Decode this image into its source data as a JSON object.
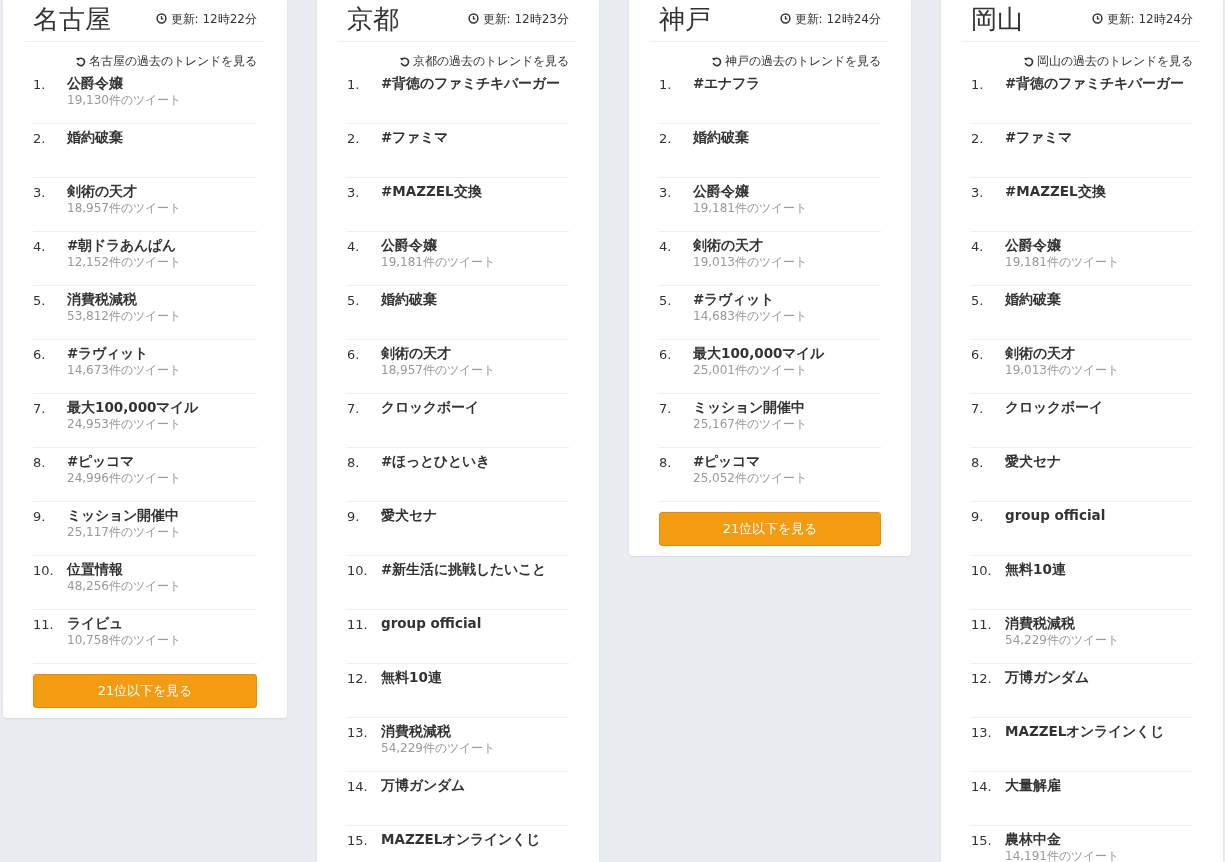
{
  "regions": [
    {
      "city": "名古屋",
      "updated": "更新: 12時22分",
      "history_link": "名古屋の過去のトレンドを見る",
      "trends": [
        {
          "rank": "1.",
          "title": "公爵令嬢",
          "count": "19,130件のツイート"
        },
        {
          "rank": "2.",
          "title": "婚約破棄"
        },
        {
          "rank": "3.",
          "title": "剣術の天才",
          "count": "18,957件のツイート"
        },
        {
          "rank": "4.",
          "title": "#朝ドラあんぱん",
          "count": "12,152件のツイート"
        },
        {
          "rank": "5.",
          "title": "消費税減税",
          "count": "53,812件のツイート"
        },
        {
          "rank": "6.",
          "title": "#ラヴィット",
          "count": "14,673件のツイート"
        },
        {
          "rank": "7.",
          "title": "最大100,000マイル",
          "count": "24,953件のツイート"
        },
        {
          "rank": "8.",
          "title": "#ピッコマ",
          "count": "24,996件のツイート"
        },
        {
          "rank": "9.",
          "title": "ミッション開催中",
          "count": "25,117件のツイート"
        },
        {
          "rank": "10.",
          "title": "位置情報",
          "count": "48,256件のツイート"
        },
        {
          "rank": "11.",
          "title": "ライビュ",
          "count": "10,758件のツイート"
        }
      ],
      "more_button": "21位以下を見る"
    },
    {
      "city": "京都",
      "updated": "更新: 12時23分",
      "history_link": "京都の過去のトレンドを見る",
      "trends": [
        {
          "rank": "1.",
          "title": "#背徳のファミチキバーガー"
        },
        {
          "rank": "2.",
          "title": "#ファミマ"
        },
        {
          "rank": "3.",
          "title": "#MAZZEL交換"
        },
        {
          "rank": "4.",
          "title": "公爵令嬢",
          "count": "19,181件のツイート"
        },
        {
          "rank": "5.",
          "title": "婚約破棄"
        },
        {
          "rank": "6.",
          "title": "剣術の天才",
          "count": "18,957件のツイート"
        },
        {
          "rank": "7.",
          "title": "クロックボーイ"
        },
        {
          "rank": "8.",
          "title": "#ほっとひといき"
        },
        {
          "rank": "9.",
          "title": "愛犬セナ"
        },
        {
          "rank": "10.",
          "title": "#新生活に挑戦したいこと"
        },
        {
          "rank": "11.",
          "title": "group official"
        },
        {
          "rank": "12.",
          "title": "無料10連"
        },
        {
          "rank": "13.",
          "title": "消費税減税",
          "count": "54,229件のツイート"
        },
        {
          "rank": "14.",
          "title": "万博ガンダム"
        },
        {
          "rank": "15.",
          "title": "MAZZELオンラインくじ"
        }
      ]
    },
    {
      "city": "神戸",
      "updated": "更新: 12時24分",
      "history_link": "神戸の過去のトレンドを見る",
      "trends": [
        {
          "rank": "1.",
          "title": "#エナフラ"
        },
        {
          "rank": "2.",
          "title": "婚約破棄"
        },
        {
          "rank": "3.",
          "title": "公爵令嬢",
          "count": "19,181件のツイート"
        },
        {
          "rank": "4.",
          "title": "剣術の天才",
          "count": "19,013件のツイート"
        },
        {
          "rank": "5.",
          "title": "#ラヴィット",
          "count": "14,683件のツイート"
        },
        {
          "rank": "6.",
          "title": "最大100,000マイル",
          "count": "25,001件のツイート"
        },
        {
          "rank": "7.",
          "title": "ミッション開催中",
          "count": "25,167件のツイート"
        },
        {
          "rank": "8.",
          "title": "#ピッコマ",
          "count": "25,052件のツイート"
        }
      ],
      "more_button": "21位以下を見る"
    },
    {
      "city": "岡山",
      "updated": "更新: 12時24分",
      "history_link": "岡山の過去のトレンドを見る",
      "trends": [
        {
          "rank": "1.",
          "title": "#背徳のファミチキバーガー"
        },
        {
          "rank": "2.",
          "title": "#ファミマ"
        },
        {
          "rank": "3.",
          "title": "#MAZZEL交換"
        },
        {
          "rank": "4.",
          "title": "公爵令嬢",
          "count": "19,181件のツイート"
        },
        {
          "rank": "5.",
          "title": "婚約破棄"
        },
        {
          "rank": "6.",
          "title": "剣術の天才",
          "count": "19,013件のツイート"
        },
        {
          "rank": "7.",
          "title": "クロックボーイ"
        },
        {
          "rank": "8.",
          "title": "愛犬セナ"
        },
        {
          "rank": "9.",
          "title": "group official"
        },
        {
          "rank": "10.",
          "title": "無料10連"
        },
        {
          "rank": "11.",
          "title": "消費税減税",
          "count": "54,229件のツイート"
        },
        {
          "rank": "12.",
          "title": "万博ガンダム"
        },
        {
          "rank": "13.",
          "title": "MAZZELオンラインくじ"
        },
        {
          "rank": "14.",
          "title": "大量解雇"
        },
        {
          "rank": "15.",
          "title": "農林中金",
          "count": "14,191件のツイート"
        }
      ]
    }
  ]
}
